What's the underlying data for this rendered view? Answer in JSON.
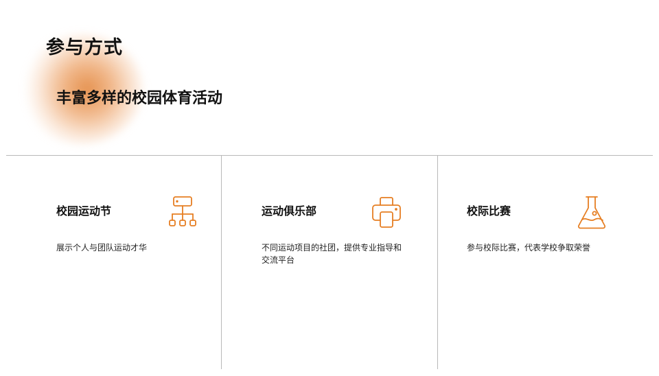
{
  "header": {
    "title": "参与方式",
    "subtitle": "丰富多样的校园体育活动"
  },
  "theme": {
    "accent": "#E67E22"
  },
  "cards": [
    {
      "title": "校园运动节",
      "description": "展示个人与团队运动才华",
      "icon": "hierarchy-icon"
    },
    {
      "title": "运动俱乐部",
      "description": "不同运动项目的社团，提供专业指导和交流平台",
      "icon": "printer-icon"
    },
    {
      "title": "校际比赛",
      "description": "参与校际比赛，代表学校争取荣誉",
      "icon": "flask-icon"
    }
  ]
}
